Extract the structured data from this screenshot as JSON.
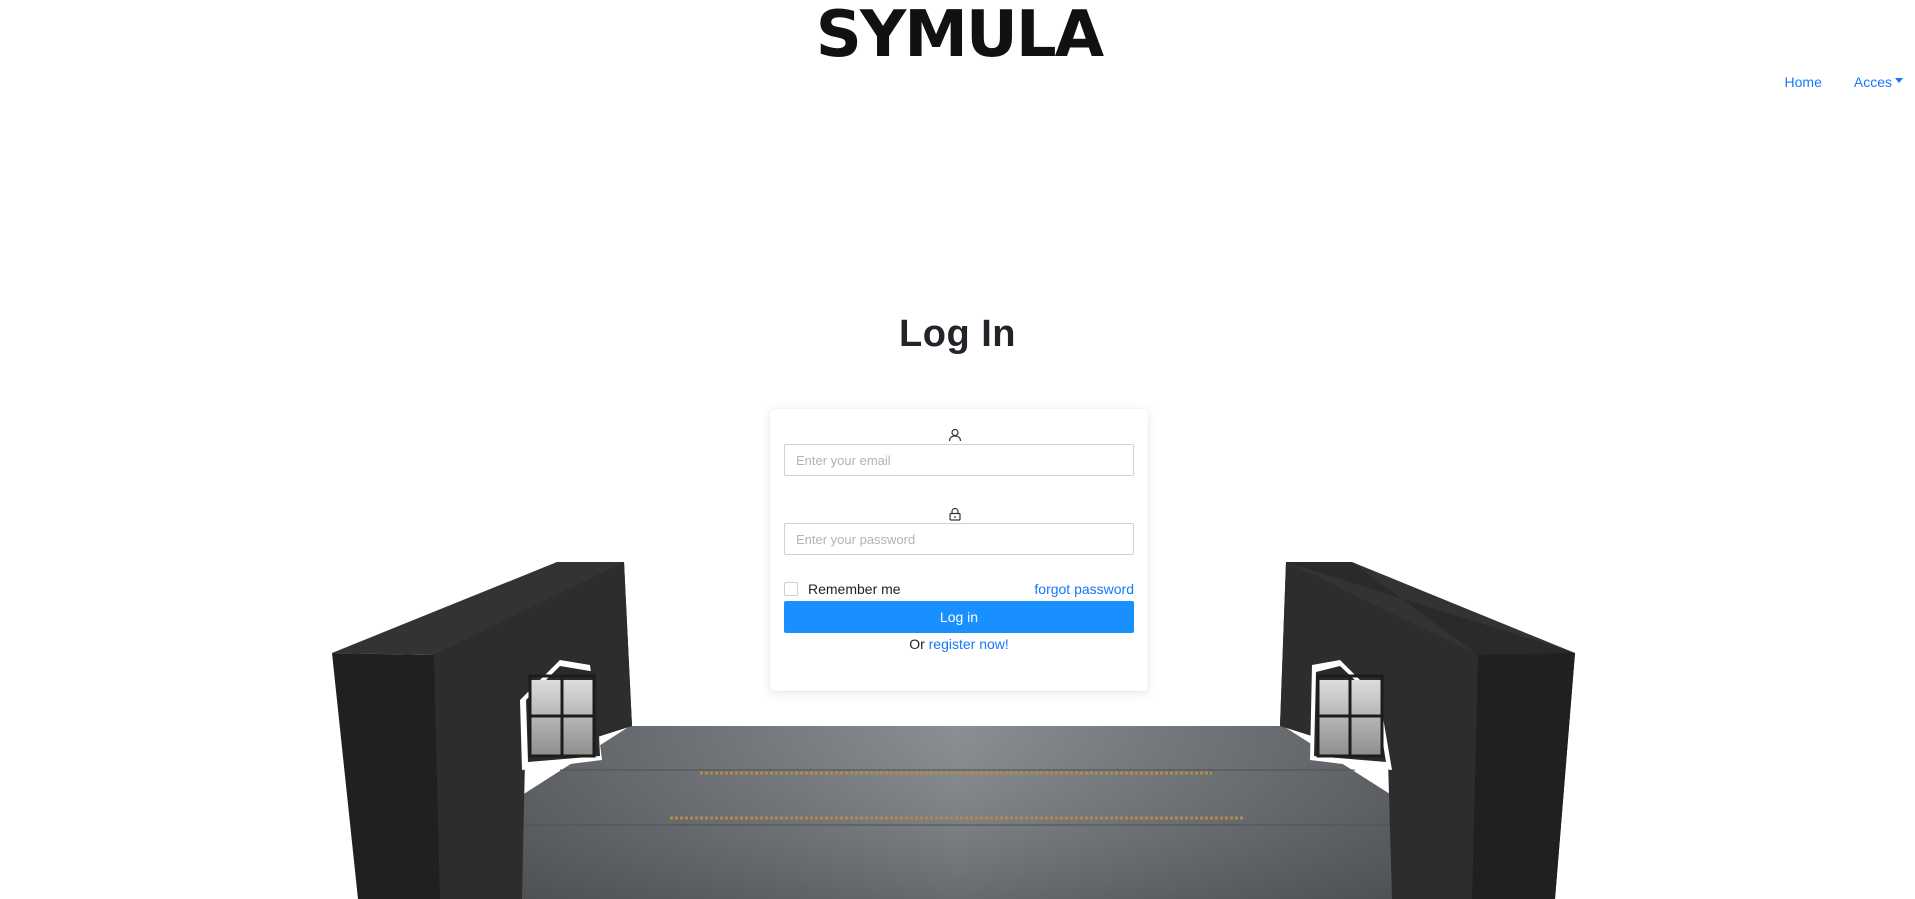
{
  "header": {
    "logo_text": "SYMULA",
    "nav": {
      "home_label": "Home",
      "access_label": "Acces"
    }
  },
  "login": {
    "title": "Log In",
    "email": {
      "icon": "user-icon",
      "placeholder": "Enter your email",
      "value": ""
    },
    "password": {
      "icon": "lock-icon",
      "placeholder": "Enter your password",
      "value": ""
    },
    "remember_label": "Remember me",
    "remember_checked": false,
    "forgot_label": "forgot password",
    "submit_label": "Log in",
    "register_prefix": "Or",
    "register_label": "register now!"
  },
  "colors": {
    "primary": "#1890ff",
    "link": "#1677ff",
    "scene_wall": "#2e2e2e",
    "scene_floor": "#5f6368"
  }
}
